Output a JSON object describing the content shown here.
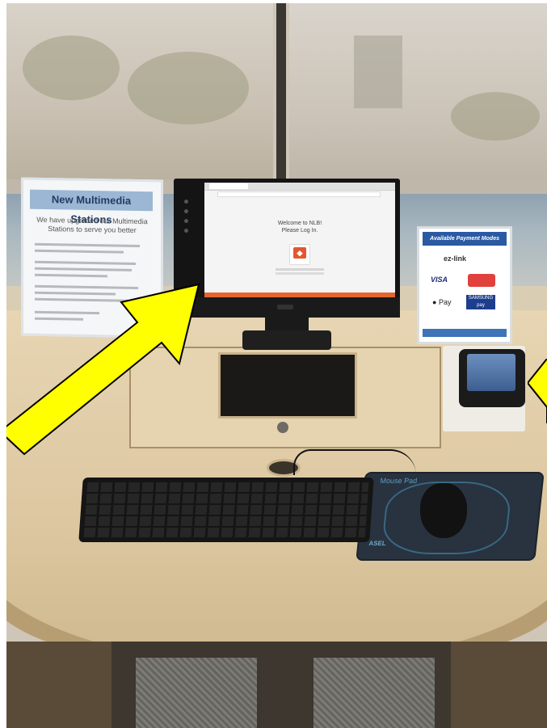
{
  "scene": {
    "kind": "library multimedia kiosk photograph",
    "colors": {
      "arrow": "#ffff00",
      "arrow_outline": "#000000",
      "table": "#dcc7a0",
      "screen_footer": "#e2662f",
      "sign_title_bg": "#9bb7d3",
      "sign_title_text": "#1f3c67",
      "payment_header": "#2b5aa3"
    },
    "highlight_arrows": [
      {
        "points_to": "monitor",
        "direction": "up-right"
      },
      {
        "points_to": "payment terminal",
        "direction": "left",
        "partially_visible": true
      }
    ]
  },
  "monitor": {
    "welcome_line1": "Welcome to NLB!",
    "welcome_line2": "Please Log In.",
    "login_icon": "nlb-login-icon"
  },
  "sign_left": {
    "title": "New Multimedia Stations",
    "intro_line1": "We have upgraded our Multimedia",
    "intro_line2": "Stations to serve you better"
  },
  "sign_right": {
    "title": "Available Payment Modes",
    "ezlink": "ez-link",
    "visa": "VISA",
    "apple_pay": "Pay",
    "samsung_pay": "SAMSUNG pay"
  },
  "mousepad": {
    "label": "Mouse Pad",
    "brand": "ASEL"
  }
}
